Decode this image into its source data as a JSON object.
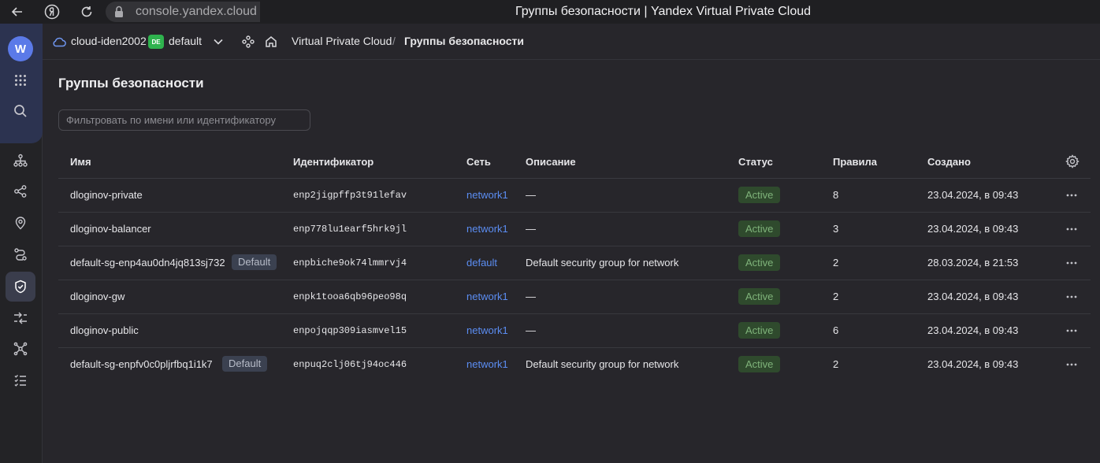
{
  "browser": {
    "url": "console.yandex.cloud",
    "window_title": "Группы безопасности | Yandex Virtual Private Cloud"
  },
  "header": {
    "cloud_name": "cloud-iden2002",
    "folder_badge": "DE",
    "folder_name": "default",
    "breadcrumb_service": "Virtual Private Cloud",
    "breadcrumb_separator": "/",
    "breadcrumb_current": "Группы безопасности"
  },
  "page": {
    "title": "Группы безопасности",
    "filter_placeholder": "Фильтровать по имени или идентификатору"
  },
  "table": {
    "columns": {
      "name": "Имя",
      "id": "Идентификатор",
      "network": "Сеть",
      "description": "Описание",
      "status": "Статус",
      "rules": "Правила",
      "created": "Создано"
    },
    "rows": [
      {
        "name": "dloginov-private",
        "badge": "",
        "id": "enp2jigpffp3t91lefav",
        "network": "network1",
        "description": "—",
        "status": "Active",
        "rules": "8",
        "created": "23.04.2024, в 09:43"
      },
      {
        "name": "dloginov-balancer",
        "badge": "",
        "id": "enp778lu1earf5hrk9jl",
        "network": "network1",
        "description": "—",
        "status": "Active",
        "rules": "3",
        "created": "23.04.2024, в 09:43"
      },
      {
        "name": "default-sg-enp4au0dn4jq813sj732",
        "badge": "Default",
        "id": "enpbiche9ok74lmmrvj4",
        "network": "default",
        "description": "Default security group for network",
        "status": "Active",
        "rules": "2",
        "created": "28.03.2024, в 21:53"
      },
      {
        "name": "dloginov-gw",
        "badge": "",
        "id": "enpk1tooa6qb96peo98q",
        "network": "network1",
        "description": "—",
        "status": "Active",
        "rules": "2",
        "created": "23.04.2024, в 09:43"
      },
      {
        "name": "dloginov-public",
        "badge": "",
        "id": "enpojqqp309iasmvel15",
        "network": "network1",
        "description": "—",
        "status": "Active",
        "rules": "6",
        "created": "23.04.2024, в 09:43"
      },
      {
        "name": "default-sg-enpfv0c0pljrfbq1i1k7",
        "badge": "Default",
        "id": "enpuq2clj06tj94oc446",
        "network": "network1",
        "description": "Default security group for network",
        "status": "Active",
        "rules": "2",
        "created": "23.04.2024, в 09:43"
      }
    ]
  },
  "icons": {
    "back": "arrow-left-icon",
    "yandex": "yandex-logo-icon",
    "reload": "reload-icon",
    "lock": "lock-icon",
    "cloud": "cloud-icon",
    "chevron": "chevron-down-icon",
    "services": "services-icon",
    "home": "home-icon",
    "settings": "gear-icon",
    "more": "ellipsis-icon"
  },
  "colors": {
    "accent": "#5b8df2",
    "status_active_bg": "#2f4a2d",
    "status_active_text": "#7fb37a",
    "background": "#27262b"
  }
}
